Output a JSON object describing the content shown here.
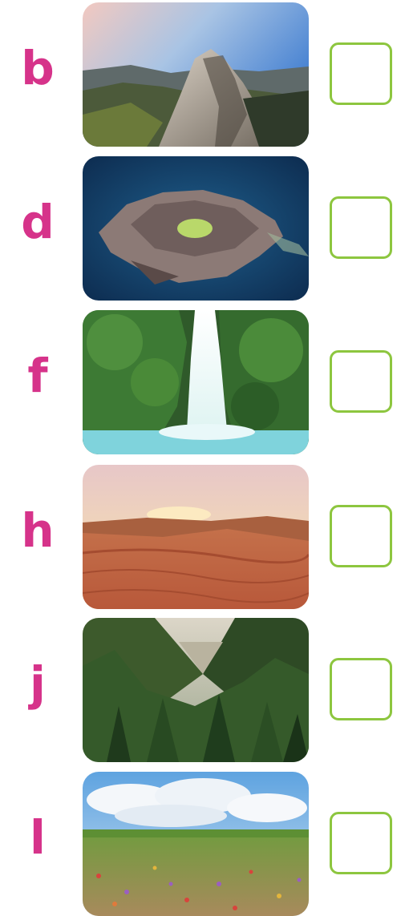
{
  "items": [
    {
      "letter": "b",
      "image": "mountain-peak-photo",
      "answer": ""
    },
    {
      "letter": "d",
      "image": "volcanic-island-photo",
      "answer": ""
    },
    {
      "letter": "f",
      "image": "waterfall-photo",
      "answer": ""
    },
    {
      "letter": "h",
      "image": "desert-dunes-photo",
      "answer": ""
    },
    {
      "letter": "j",
      "image": "forest-valley-photo",
      "answer": ""
    },
    {
      "letter": "l",
      "image": "meadow-field-photo",
      "answer": ""
    }
  ],
  "colors": {
    "letter": "#d6338a",
    "box_border": "#8dc63f"
  }
}
